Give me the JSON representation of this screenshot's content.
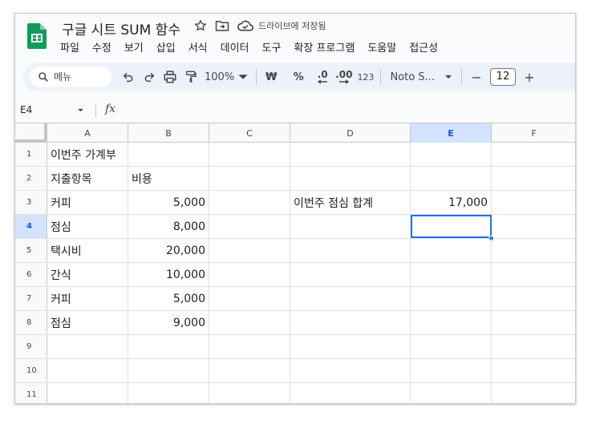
{
  "app": {
    "doc_title": "구글 시트 SUM 함수",
    "save_status": "드라이브에 저장됨"
  },
  "menu": [
    "파일",
    "수정",
    "보기",
    "삽입",
    "서식",
    "데이터",
    "도구",
    "확장 프로그램",
    "도움말",
    "접근성"
  ],
  "toolbar": {
    "search_placeholder": "메뉴",
    "zoom": "100%",
    "currency": "₩",
    "percent": "%",
    "decrease_decimal": ".0",
    "increase_decimal": ".00",
    "number_format": "123",
    "font": "Noto S...",
    "font_size": "12",
    "minus": "−",
    "plus": "+"
  },
  "formula_bar": {
    "name_box": "E4",
    "fx": "fx"
  },
  "sheet": {
    "columns": [
      "A",
      "B",
      "C",
      "D",
      "E",
      "F"
    ],
    "selected_column": "E",
    "selected_row": "4",
    "rows": [
      {
        "num": "1",
        "cells": [
          "이번주 가계부",
          "",
          "",
          "",
          "",
          ""
        ]
      },
      {
        "num": "2",
        "cells": [
          "지출항목",
          "비용",
          "",
          "",
          "",
          ""
        ]
      },
      {
        "num": "3",
        "cells": [
          "커피",
          "5,000",
          "",
          "이번주 점심 합계",
          "17,000",
          ""
        ]
      },
      {
        "num": "4",
        "cells": [
          "점심",
          "8,000",
          "",
          "",
          "",
          ""
        ]
      },
      {
        "num": "5",
        "cells": [
          "택시비",
          "20,000",
          "",
          "",
          "",
          ""
        ]
      },
      {
        "num": "6",
        "cells": [
          "간식",
          "10,000",
          "",
          "",
          "",
          ""
        ]
      },
      {
        "num": "7",
        "cells": [
          "커피",
          "5,000",
          "",
          "",
          "",
          ""
        ]
      },
      {
        "num": "8",
        "cells": [
          "점심",
          "9,000",
          "",
          "",
          "",
          ""
        ]
      },
      {
        "num": "9",
        "cells": [
          "",
          "",
          "",
          "",
          "",
          ""
        ]
      },
      {
        "num": "10",
        "cells": [
          "",
          "",
          "",
          "",
          "",
          ""
        ]
      },
      {
        "num": "11",
        "cells": [
          "",
          "",
          "",
          "",
          "",
          ""
        ]
      }
    ]
  },
  "colors": {
    "logo_green": "#0f9d58",
    "selection_blue": "#1a73e8",
    "header_selected": "#d3e3fd"
  }
}
